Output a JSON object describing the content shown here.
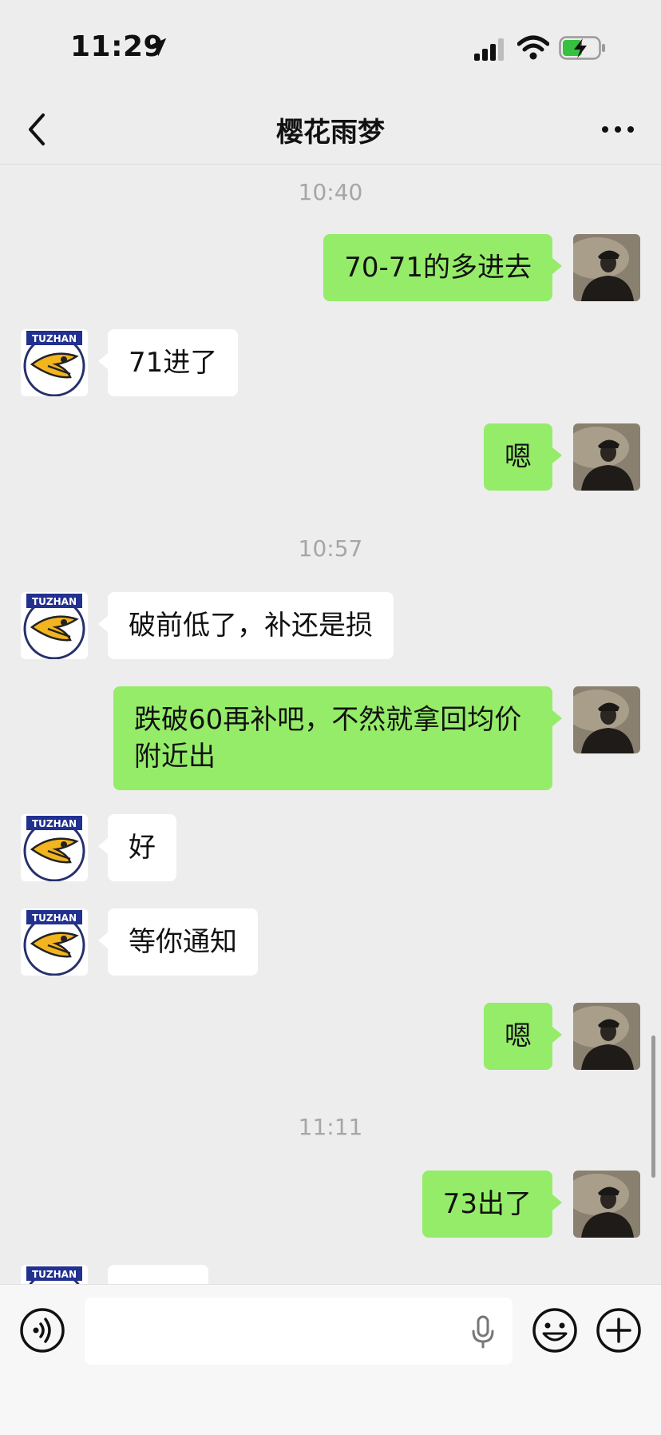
{
  "status_bar": {
    "time": "11:29"
  },
  "nav": {
    "title": "樱花雨梦"
  },
  "contact_avatar_label": "TUZHAN",
  "messages": [
    {
      "type": "time",
      "text": "10:40"
    },
    {
      "type": "me",
      "text": "70-71的多进去"
    },
    {
      "type": "other",
      "text": "71进了"
    },
    {
      "type": "me",
      "text": "嗯"
    },
    {
      "type": "time",
      "text": "10:57"
    },
    {
      "type": "other",
      "text": "破前低了，补还是损"
    },
    {
      "type": "me",
      "text": "跌破60再补吧，不然就拿回均价附近出"
    },
    {
      "type": "other",
      "text": "好"
    },
    {
      "type": "other",
      "text": "等你通知"
    },
    {
      "type": "me",
      "text": "嗯"
    },
    {
      "type": "time",
      "text": "11:11"
    },
    {
      "type": "me",
      "text": "73出了"
    },
    {
      "type": "other",
      "text": ""
    }
  ],
  "input": {
    "value": "",
    "placeholder": ""
  },
  "colors": {
    "my_bubble": "#95ec69",
    "other_bubble": "#ffffff",
    "background": "#ededed"
  }
}
